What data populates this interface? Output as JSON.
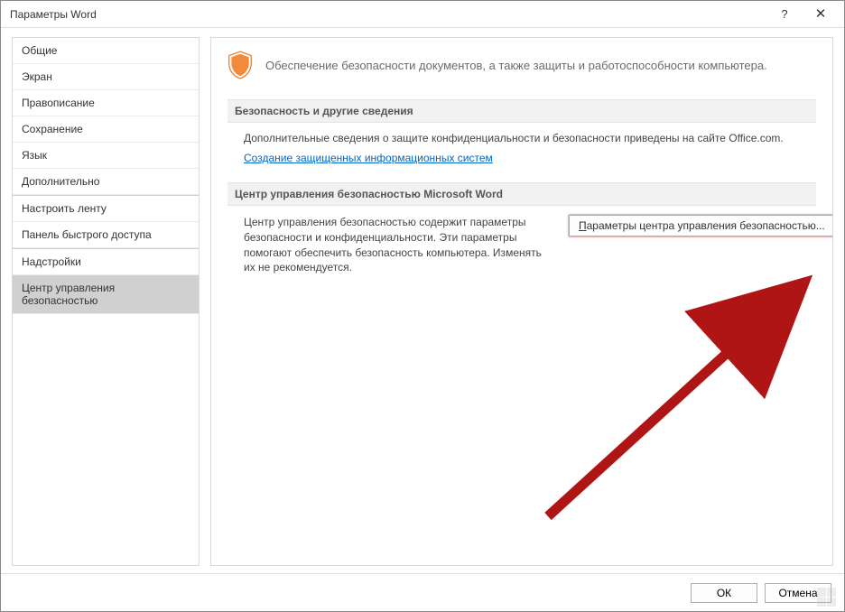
{
  "title": "Параметры Word",
  "sidebar": {
    "items": [
      {
        "label": "Общие"
      },
      {
        "label": "Экран"
      },
      {
        "label": "Правописание"
      },
      {
        "label": "Сохранение"
      },
      {
        "label": "Язык"
      },
      {
        "label": "Дополнительно"
      },
      {
        "label": "Настроить ленту"
      },
      {
        "label": "Панель быстрого доступа"
      },
      {
        "label": "Надстройки"
      },
      {
        "label": "Центр управления безопасностью"
      }
    ],
    "selected_index": 9
  },
  "content": {
    "intro": "Обеспечение безопасности документов, а также защиты и работоспособности компьютера.",
    "section1_header": "Безопасность и другие сведения",
    "section1_body": "Дополнительные сведения о защите конфиденциальности и безопасности приведены на сайте Office.com.",
    "section1_link": "Создание защищенных информационных систем",
    "section2_header": "Центр управления безопасностью Microsoft Word",
    "section2_body": "Центр управления безопасностью содержит параметры безопасности и конфиденциальности. Эти параметры помогают обеспечить безопасность компьютера. Изменять их не рекомендуется.",
    "trust_button_prefix": "П",
    "trust_button_rest": "араметры центра управления безопасностью..."
  },
  "footer": {
    "ok": "ОК",
    "cancel": "Отмена"
  }
}
